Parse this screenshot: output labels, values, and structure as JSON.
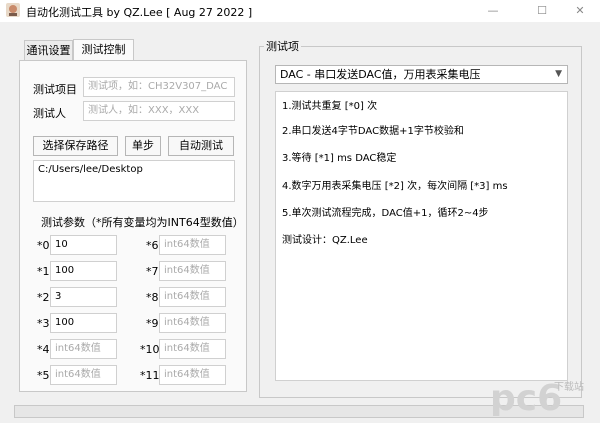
{
  "window": {
    "title": "自动化测试工具 by QZ.Lee  [ Aug 27 2022 ]",
    "controls": [
      "—",
      "☐",
      "✕"
    ]
  },
  "tabs": [
    {
      "label": "通讯设置",
      "active": false
    },
    {
      "label": "测试控制",
      "active": true
    }
  ],
  "form": {
    "project_label": "测试项目",
    "project_placeholder": "测试项，如：CH32V307_DAC",
    "tester_label": "测试人",
    "tester_placeholder": "测试人，如：XXX，XXX",
    "buttons": [
      "选择保存路径",
      "单步",
      "自动测试"
    ],
    "save_path": "C:/Users/lee/Desktop"
  },
  "params": {
    "header": "测试参数（*所有变量均为INT64型数值）",
    "left": [
      {
        "label": "*0",
        "value": "10",
        "placeholder": ""
      },
      {
        "label": "*1",
        "value": "100",
        "placeholder": ""
      },
      {
        "label": "*2",
        "value": "3",
        "placeholder": ""
      },
      {
        "label": "*3",
        "value": "100",
        "placeholder": ""
      },
      {
        "label": "*4",
        "value": "",
        "placeholder": "int64数值"
      },
      {
        "label": "*5",
        "value": "",
        "placeholder": "int64数值"
      }
    ],
    "right": [
      {
        "label": "*6",
        "value": "",
        "placeholder": "int64数值"
      },
      {
        "label": "*7",
        "value": "",
        "placeholder": "int64数值"
      },
      {
        "label": "*8",
        "value": "",
        "placeholder": "int64数值"
      },
      {
        "label": "*9",
        "value": "",
        "placeholder": "int64数值"
      },
      {
        "label": "*10",
        "value": "",
        "placeholder": "int64数值"
      },
      {
        "label": "*11",
        "value": "",
        "placeholder": "int64数值"
      }
    ]
  },
  "test_item": {
    "group_title": "测试项",
    "selected": "DAC - 串口发送DAC值，万用表采集电压",
    "description": [
      "1.测试共重复 [*0] 次",
      "2.串口发送4字节DAC数据+1字节校验和",
      "3.等待 [*1] ms DAC稳定",
      "4.数字万用表采集电压 [*2] 次，每次间隔 [*3] ms",
      "5.单次测试流程完成，DAC值+1，循环2~4步",
      "测试设计：QZ.Lee"
    ]
  },
  "watermark": {
    "text": "下载站",
    "color": "#d2d2d2"
  }
}
